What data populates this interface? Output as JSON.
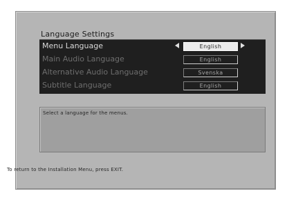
{
  "title": "Language Settings",
  "settings": [
    {
      "label": "Menu Language",
      "value": "English"
    },
    {
      "label": "Main Audio Language",
      "value": "English"
    },
    {
      "label": "Alternative Audio Language",
      "value": "Svenska"
    },
    {
      "label": "Subtitle Language",
      "value": "English"
    }
  ],
  "help_text": "Select a language for the menus.",
  "footer": "To return to the Installation Menu, press EXIT.",
  "icons": {
    "left": "left-arrow-icon",
    "right": "right-arrow-icon"
  }
}
